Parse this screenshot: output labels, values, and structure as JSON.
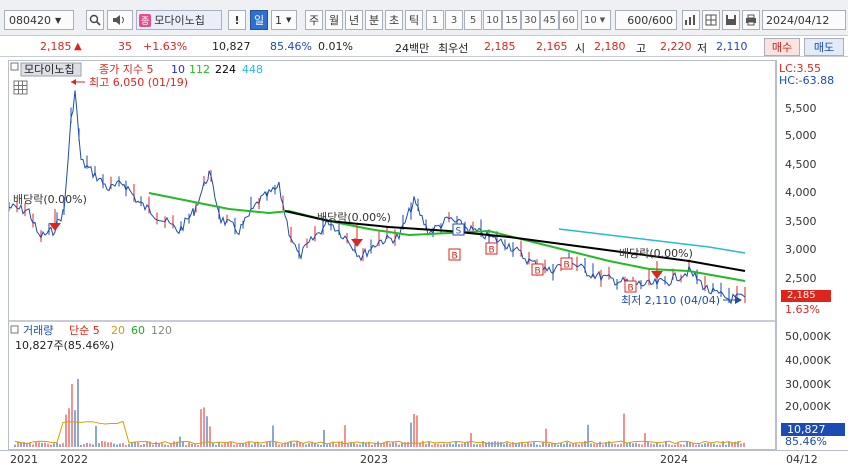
{
  "toolbar": {
    "stock_code": "080420",
    "stock_name_tag": "종",
    "stock_name": "모다이노칩",
    "period_day": "일",
    "period_count": "1",
    "period_week": "주",
    "period_month": "월",
    "period_year": "년",
    "period_minute": "분",
    "period_second": "초",
    "period_tick": "틱",
    "interval_buttons": [
      "1",
      "3",
      "5",
      "10",
      "15",
      "30",
      "45",
      "60"
    ],
    "interval_select": "10",
    "bar_count": "600/600",
    "date": "2024/04/12"
  },
  "quote": {
    "price": "2,185",
    "change_arrow": "▲",
    "change": "35",
    "change_pct": "+1.63%",
    "volume": "10,827",
    "volume_ratio": "85.46%",
    "turnover": "0.01%",
    "period_label": "24백만",
    "best_bid_label": "최우선",
    "ask_price": "2,185",
    "bid_price": "2,165",
    "open_label": "시",
    "open": "2,180",
    "high_label": "고",
    "high": "2,220",
    "low_label": "저",
    "low": "2,110",
    "buy_button": "매수",
    "sell_button": "매도"
  },
  "price_panel": {
    "title": "모다이노칩",
    "ma_label": "종가 지수 5",
    "ma_periods": [
      {
        "label": "10",
        "color": "#2a2ae0"
      },
      {
        "label": "112",
        "color": "#22bb22"
      },
      {
        "label": "224",
        "color": "#000000"
      },
      {
        "label": "448",
        "color": "#22bbdd"
      }
    ],
    "high_annotation": "최고 6,050 (01/19)",
    "low_annotation": "최저 2,110 (04/04)",
    "dividend_labels": [
      "배당락(0.00%)",
      "배당락(0.00%)",
      "배당락(0.00%)"
    ],
    "lc": "LC:3.55",
    "hc": "HC:-63.88",
    "y_ticks": [
      "5,500",
      "5,000",
      "4,500",
      "4,000",
      "3,500",
      "3,000",
      "2,500"
    ],
    "current_price_tag": "2,185",
    "current_change_tag": "1.63%"
  },
  "volume_panel": {
    "title": "거래량",
    "ma_label": "단순 5",
    "ma_periods": [
      {
        "label": "20",
        "color": "#d4a000"
      },
      {
        "label": "60",
        "color": "#22aa22"
      },
      {
        "label": "120",
        "color": "#888888"
      }
    ],
    "volume_text": "10,827주(85.46%)",
    "y_ticks": [
      "50,000K",
      "40,000K",
      "30,000K",
      "20,000K"
    ],
    "current_volume_tag": "10,827",
    "current_ratio_tag": "85.46%"
  },
  "x_axis": [
    "2021",
    "2022",
    "2023",
    "2024",
    "04/12"
  ],
  "colors": {
    "up": "#e0241b",
    "down": "#1d4bb5",
    "ma10": "#2a2ae0",
    "ma112": "#22bb22",
    "ma224": "#000000",
    "ma448": "#22bbdd"
  }
}
